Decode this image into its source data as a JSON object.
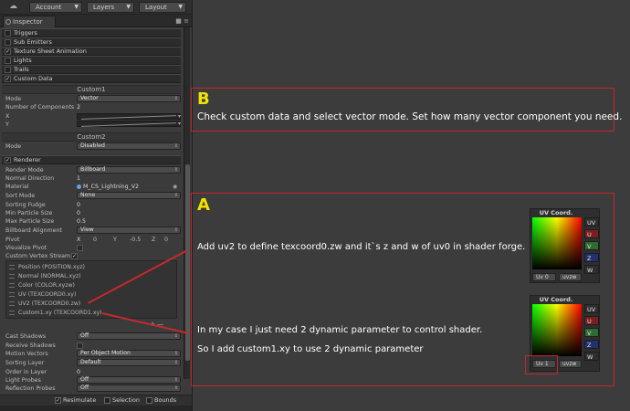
{
  "toolbar": {
    "account": "Account",
    "layers": "Layers",
    "layout": "Layout"
  },
  "tab": {
    "label": "Inspector"
  },
  "modules": {
    "triggers": "Triggers",
    "sub_emitters": "Sub Emitters",
    "texture_sheet_animation": "Texture Sheet Animation",
    "lights": "Lights",
    "trails": "Trails",
    "custom_data": "Custom Data",
    "renderer": "Renderer"
  },
  "custom_data": {
    "custom1_title": "Custom1",
    "mode_label": "Mode",
    "mode_value": "Vector",
    "num_components_label": "Number of Components",
    "num_components_value": "2",
    "x_label": "X",
    "y_label": "Y",
    "custom2_title": "Custom2",
    "mode2_label": "Mode",
    "mode2_value": "Disabled"
  },
  "renderer": {
    "render_mode": {
      "label": "Render Mode",
      "value": "Billboard"
    },
    "normal_direction": {
      "label": "Normal Direction",
      "value": "1"
    },
    "material": {
      "label": "Material",
      "value": "M_CS_Lightning_V2"
    },
    "sort_mode": {
      "label": "Sort Mode",
      "value": "None"
    },
    "sorting_fudge": {
      "label": "Sorting Fudge",
      "value": "0"
    },
    "min_particle_size": {
      "label": "Min Particle Size",
      "value": "0"
    },
    "max_particle_size": {
      "label": "Max Particle Size",
      "value": "0.5"
    },
    "billboard_alignment": {
      "label": "Billboard Alignment",
      "value": "View"
    },
    "pivot": {
      "label": "Pivot",
      "x_label": "X",
      "x": "0",
      "y_label": "Y",
      "y": "-0.5",
      "z_label": "Z",
      "z": "0"
    },
    "visualize_pivot": {
      "label": "Visualize Pivot"
    },
    "custom_vertex_streams": {
      "label": "Custom Vertex Stream"
    },
    "streams": [
      "Position (POSITION.xyz)",
      "Normal (NORMAL.xyz)",
      "Color (COLOR.xyzw)",
      "UV (TEXCOORD0.xy)",
      "UV2 (TEXCOORD0.zw)",
      "Custom1.xy (TEXCOORD1.xy)"
    ],
    "cast_shadows": {
      "label": "Cast Shadows",
      "value": "Off"
    },
    "receive_shadows": {
      "label": "Receive Shadows"
    },
    "motion_vectors": {
      "label": "Motion Vectors",
      "value": "Per Object Motion"
    },
    "sorting_layer": {
      "label": "Sorting Layer",
      "value": "Default"
    },
    "order_in_layer": {
      "label": "Order in Layer",
      "value": "0"
    },
    "light_probes": {
      "label": "Light Probes",
      "value": "Off"
    },
    "reflection_probes": {
      "label": "Reflection Probes",
      "value": "Off"
    }
  },
  "bottom": {
    "resimulate": "Resimulate",
    "selection": "Selection",
    "bounds": "Bounds"
  },
  "annotation_b": {
    "letter": "B",
    "text": "Check custom data and select vector mode. Set how many vector component you need."
  },
  "annotation_a": {
    "letter": "A",
    "text1": "Add uv2 to define texcoord0.zw and it`s z and w of uv0 in shader forge.",
    "text2": "In my case I just need 2 dynamic parameter to control shader.",
    "text3": "So I add custom1.xy to use 2 dynamic parameter"
  },
  "uv_widget_1": {
    "title": "UV Coord.",
    "outputs": [
      "UV",
      "U",
      "V",
      "Z",
      "W"
    ],
    "uv_select": "Uv 0",
    "swizzle": "uvzw"
  },
  "uv_widget_2": {
    "title": "UV Coord.",
    "outputs": [
      "UV",
      "U",
      "V",
      "Z",
      "W"
    ],
    "uv_select": "Uv 1",
    "swizzle": "uvzw"
  },
  "colors": {
    "annotation_border": "#c0282c",
    "letter": "#f2e200",
    "note_text": "#ffffff"
  }
}
